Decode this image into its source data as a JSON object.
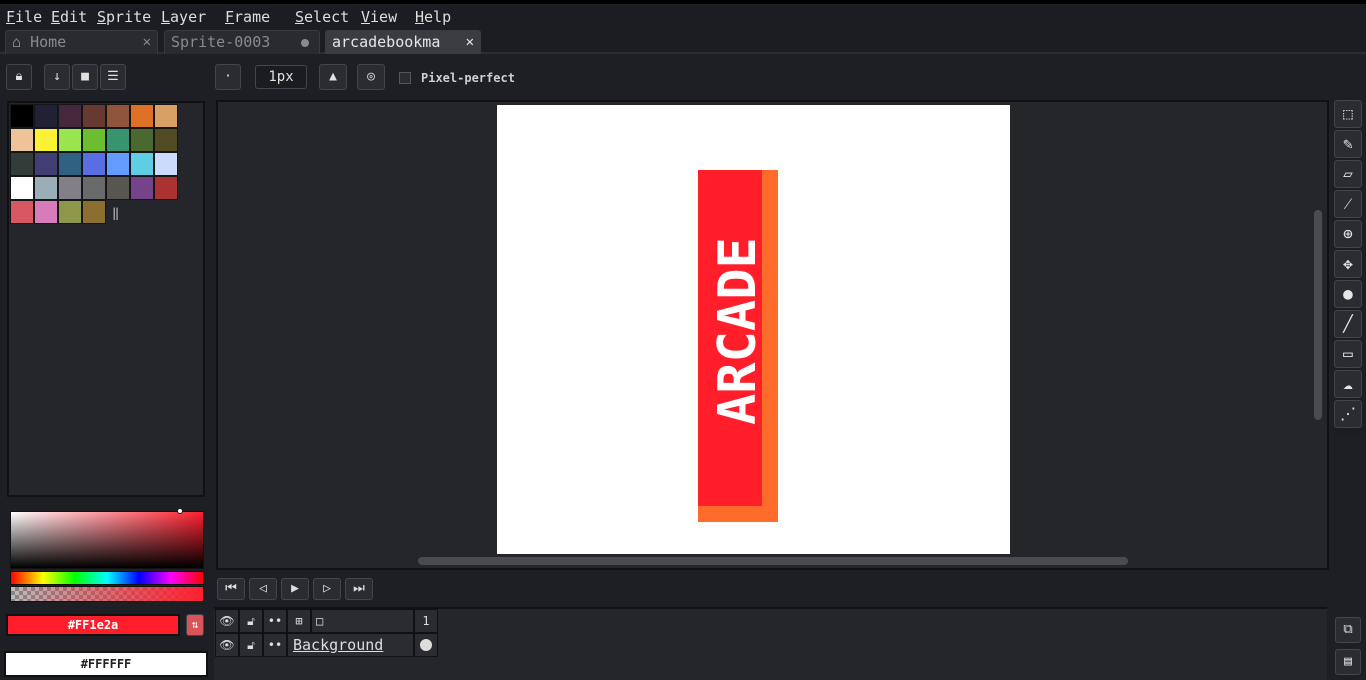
{
  "menu": [
    "File",
    "Edit",
    "Sprite",
    "Layer",
    "Frame",
    "Select",
    "View",
    "Help"
  ],
  "tabs": [
    {
      "label": "Home",
      "icon": "home-icon"
    },
    {
      "label": "Sprite-0003"
    },
    {
      "label": "arcadebookma"
    }
  ],
  "context_bar": {
    "brush_size": "1px",
    "pixel_perfect_label": "Pixel-perfect",
    "pixel_perfect_checked": false
  },
  "palette_colors": [
    "#000000",
    "#222034",
    "#45283c",
    "#663931",
    "#8f563b",
    "#df7126",
    "#d9a066",
    "#eec39a",
    "#fbf236",
    "#99e550",
    "#6abe30",
    "#37946e",
    "#4b692f",
    "#524b24",
    "#323c39",
    "#3f3f74",
    "#306082",
    "#5b6ee1",
    "#639bff",
    "#5fcde4",
    "#cbdbfc",
    "#ffffff",
    "#9badb7",
    "#847e87",
    "#696a6a",
    "#595652",
    "#76428a",
    "#ac3232",
    "#d95763",
    "#d77bba",
    "#8f974a",
    "#8a6f30"
  ],
  "foreground_color": "#FF1e2a",
  "background_color": "#FFFFFF",
  "sprite": {
    "banner_color": "#ff1e2a",
    "accent_color": "#ff6b2a",
    "vertical_text": "ARCADE"
  },
  "timeline": {
    "frame_number": "1",
    "layer_name": "Background"
  }
}
